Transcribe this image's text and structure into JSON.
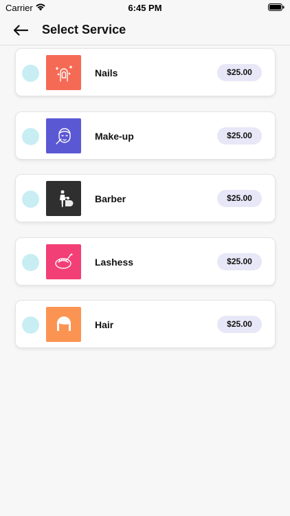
{
  "status_bar": {
    "carrier": "Carrier",
    "time": "6:45 PM"
  },
  "header": {
    "title": "Select Service",
    "back_icon": "arrow-left-icon"
  },
  "services": [
    {
      "name": "Nails",
      "price": "$25.00",
      "color": "#f56a55",
      "icon": "nails-icon"
    },
    {
      "name": "Make-up",
      "price": "$25.00",
      "color": "#5b58d4",
      "icon": "makeup-face-icon"
    },
    {
      "name": "Barber",
      "price": "$25.00",
      "color": "#2f2f2f",
      "icon": "barber-icon"
    },
    {
      "name": "Lashess",
      "price": "$25.00",
      "color": "#f23f76",
      "icon": "eyelash-icon"
    },
    {
      "name": "Hair",
      "price": "$25.00",
      "color": "#fb9453",
      "icon": "hair-icon"
    }
  ],
  "colors": {
    "radio": "#c8eef4",
    "price_badge": "#e7e7f7",
    "background": "#f7f7f7"
  }
}
